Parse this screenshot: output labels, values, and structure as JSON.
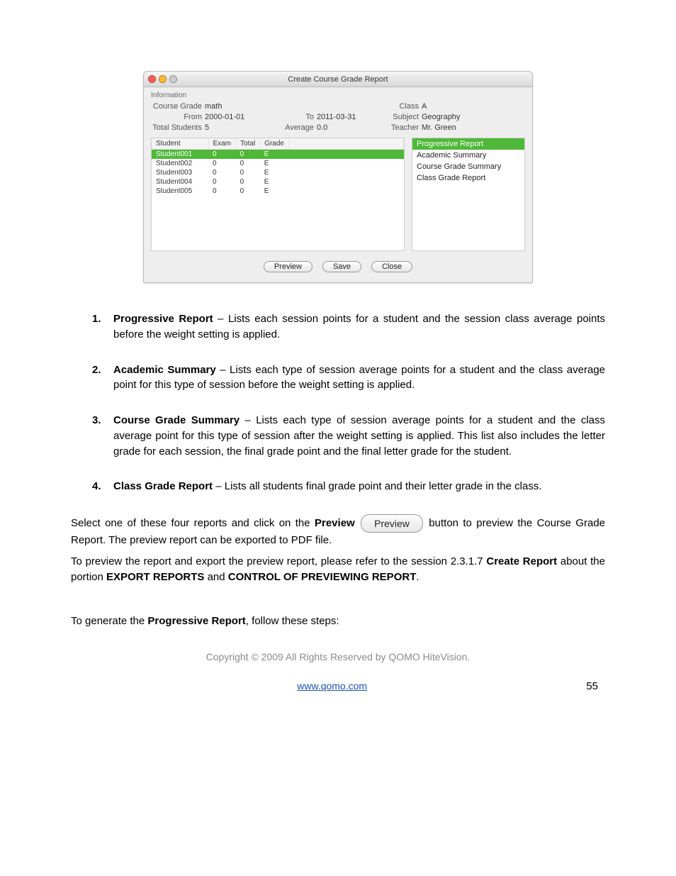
{
  "window": {
    "title": "Create Course Grade Report",
    "info_label": "Information",
    "fields": {
      "course_grade_k": "Course Grade",
      "course_grade_v": "math",
      "class_k": "Class",
      "class_v": "A",
      "from_k": "From",
      "from_v": "2000-01-01",
      "to_k": "To",
      "to_v": "2011-03-31",
      "subject_k": "Subject",
      "subject_v": "Geography",
      "total_students_k": "Total Students",
      "total_students_v": "5",
      "average_k": "Average",
      "average_v": "0.0",
      "teacher_k": "Teacher",
      "teacher_v": "Mr. Green"
    },
    "table": {
      "headers": {
        "student": "Student",
        "exam": "Exam",
        "total": "Total",
        "grade": "Grade"
      },
      "rows": [
        {
          "student": "Student001",
          "exam": "0",
          "total": "0",
          "grade": "E",
          "active": true
        },
        {
          "student": "Student002",
          "exam": "0",
          "total": "0",
          "grade": "E",
          "active": false
        },
        {
          "student": "Student003",
          "exam": "0",
          "total": "0",
          "grade": "E",
          "active": false
        },
        {
          "student": "Student004",
          "exam": "0",
          "total": "0",
          "grade": "E",
          "active": false
        },
        {
          "student": "Student005",
          "exam": "0",
          "total": "0",
          "grade": "E",
          "active": false
        }
      ]
    },
    "reports": [
      {
        "label": "Progressive Report",
        "active": true
      },
      {
        "label": "Academic Summary",
        "active": false
      },
      {
        "label": "Course Grade Summary",
        "active": false
      },
      {
        "label": "Class Grade Report",
        "active": false
      }
    ],
    "buttons": {
      "preview": "Preview",
      "save": "Save",
      "close": "Close"
    }
  },
  "list": {
    "item1": {
      "num": "1.",
      "title": "Progressive Report",
      "body": " – Lists each session points for a student and the session class average points before the weight setting is applied."
    },
    "item2": {
      "num": "2.",
      "title": "Academic Summary",
      "body": " – Lists each type of session average points for a student and the class average point for this type of session before the weight setting is applied."
    },
    "item3": {
      "num": "3.",
      "title": "Course Grade Summary",
      "body": " – Lists each type of session average points for a student and the class average point for this type of session after the weight setting is applied. This list also includes the letter grade for each session, the final grade point and the final letter grade for the student."
    },
    "item4": {
      "num": "4.",
      "title": "Class Grade Report",
      "body": " – Lists all students final grade point and their letter grade in the class."
    }
  },
  "paras": {
    "p1a": "Select one of these four reports and click on the ",
    "p1b_bold": "Preview",
    "p1_btn": "Preview",
    "p1c": "button to preview the Course Grade Report. The preview report can be exported to PDF file.",
    "p2a": "To preview the report and export the preview report, please refer to the session 2.3.1.7 ",
    "p2b_bold": "Create Report",
    "p2c": " about the portion ",
    "p2d_bold": "EXPORT REPORTS",
    "p2e": " and ",
    "p2f_bold": "CONTROL OF PREVIEWING REPORT",
    "p2g": ".",
    "p3a": "To generate the ",
    "p3b_bold": "Progressive Report",
    "p3c": ", follow these steps:"
  },
  "footer": {
    "copyright": "Copyright © 2009 All Rights Reserved by QOMO HiteVision.",
    "link": "www.qomo.com",
    "page": "55"
  }
}
